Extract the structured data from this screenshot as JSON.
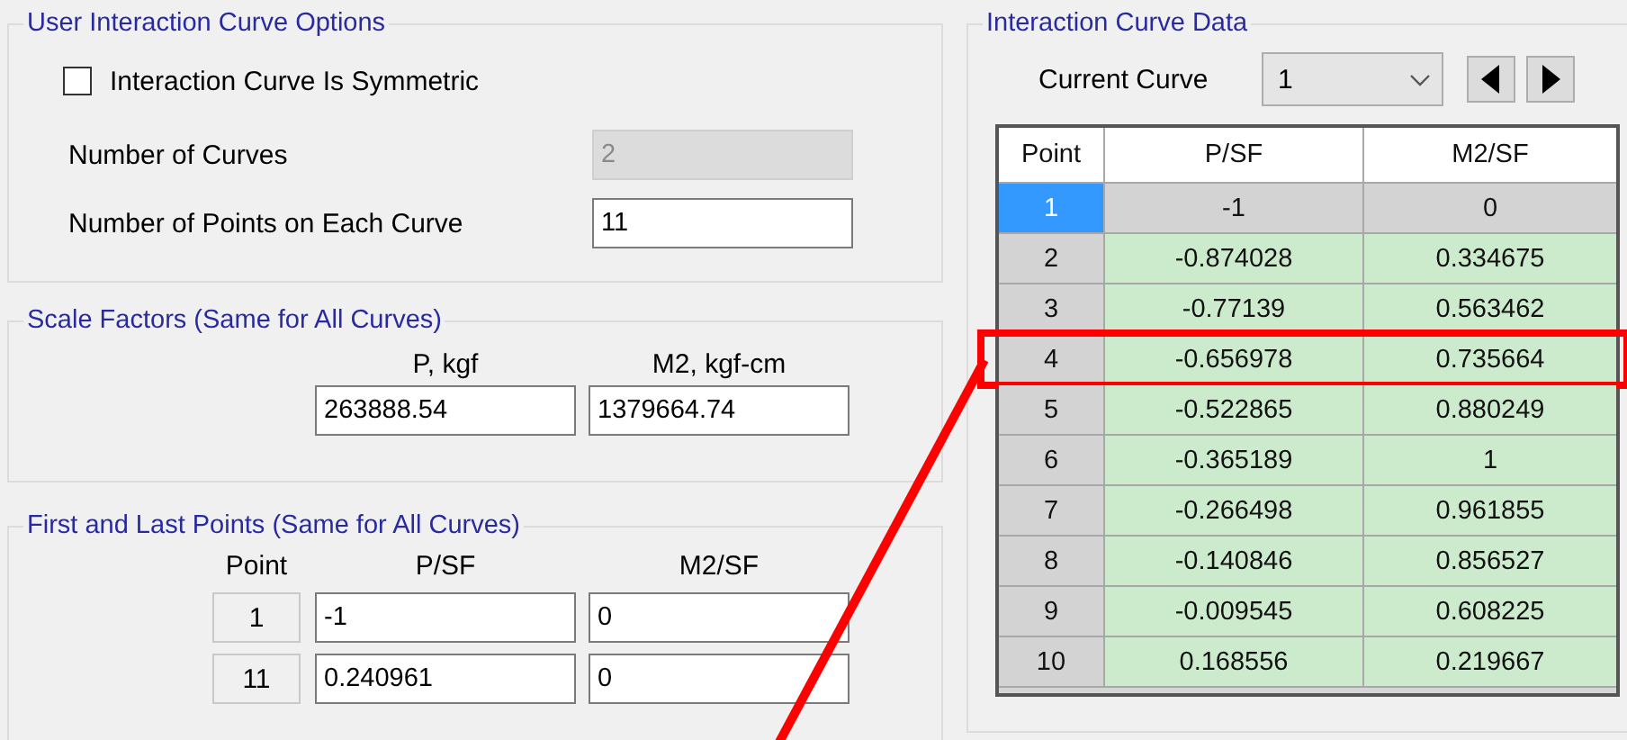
{
  "options": {
    "title": "User Interaction Curve Options",
    "symmetric": {
      "label": "Interaction Curve Is Symmetric",
      "checked": false
    },
    "fields": [
      {
        "label": "Number of Curves",
        "value": "2",
        "disabled": true
      },
      {
        "label": "Number of Points on Each Curve",
        "value": "11",
        "disabled": false
      }
    ]
  },
  "scale_factors": {
    "title": "Scale Factors (Same for All Curves)",
    "columns": [
      "P, kgf",
      "M2, kgf-cm"
    ],
    "values": [
      "263888.54",
      "1379664.74"
    ]
  },
  "end_points": {
    "title": "First and Last Points (Same for All Curves)",
    "columns": [
      "Point",
      "P/SF",
      "M2/SF"
    ],
    "rows": [
      {
        "point": "1",
        "p_sf": "-1",
        "m2_sf": "0"
      },
      {
        "point": "11",
        "p_sf": "0.240961",
        "m2_sf": "0"
      }
    ]
  },
  "curve_data": {
    "title": "Interaction Curve Data",
    "current_curve": {
      "label": "Current Curve",
      "value": "1"
    },
    "table": {
      "columns": [
        "Point",
        "P/SF",
        "M2/SF"
      ],
      "rows": [
        {
          "point": "1",
          "p_sf": "-1",
          "m2_sf": "0",
          "selected": true,
          "highlighted": false
        },
        {
          "point": "2",
          "p_sf": "-0.874028",
          "m2_sf": "0.334675",
          "selected": false,
          "highlighted": false
        },
        {
          "point": "3",
          "p_sf": "-0.77139",
          "m2_sf": "0.563462",
          "selected": false,
          "highlighted": false
        },
        {
          "point": "4",
          "p_sf": "-0.656978",
          "m2_sf": "0.735664",
          "selected": false,
          "highlighted": true
        },
        {
          "point": "5",
          "p_sf": "-0.522865",
          "m2_sf": "0.880249",
          "selected": false,
          "highlighted": false
        },
        {
          "point": "6",
          "p_sf": "-0.365189",
          "m2_sf": "1",
          "selected": false,
          "highlighted": false
        },
        {
          "point": "7",
          "p_sf": "-0.266498",
          "m2_sf": "0.961855",
          "selected": false,
          "highlighted": false
        },
        {
          "point": "8",
          "p_sf": "-0.140846",
          "m2_sf": "0.856527",
          "selected": false,
          "highlighted": false
        },
        {
          "point": "9",
          "p_sf": "-0.009545",
          "m2_sf": "0.608225",
          "selected": false,
          "highlighted": false
        },
        {
          "point": "10",
          "p_sf": "0.168556",
          "m2_sf": "0.219667",
          "selected": false,
          "highlighted": false
        }
      ]
    }
  }
}
